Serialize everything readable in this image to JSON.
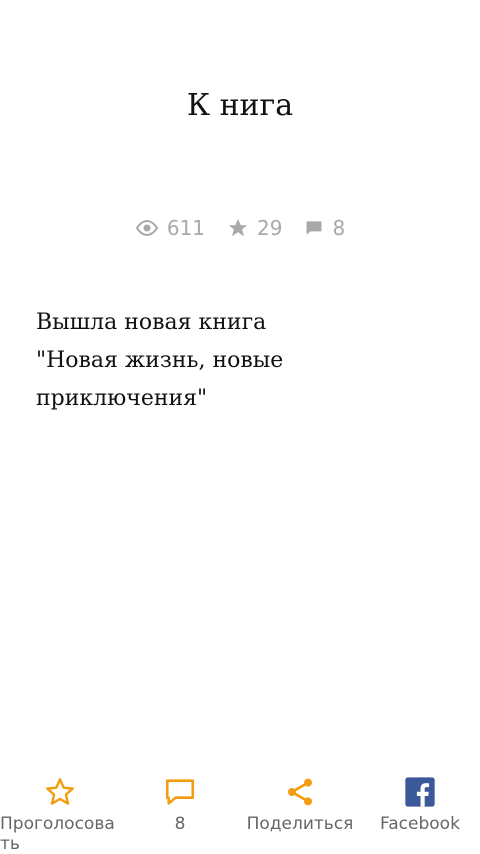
{
  "article": {
    "title": "К нига",
    "content": "Вышла новая книга \"Новая жизнь, новые приключения\""
  },
  "stats": {
    "views": "611",
    "rating": "29",
    "comments": "8"
  },
  "actions": {
    "vote_label": "Проголосовать",
    "comments_label": "8",
    "share_label": "Поделиться",
    "facebook_label": "Facebook"
  },
  "colors": {
    "accent": "#f39c12",
    "facebook": "#3b5998",
    "muted": "#a9a9a9"
  },
  "icons": {
    "views": "eye-icon",
    "rating": "star-icon",
    "comments": "comment-icon",
    "vote": "star-outline-icon",
    "comment_action": "chat-bubble-icon",
    "share": "share-icon",
    "facebook": "facebook-icon"
  }
}
